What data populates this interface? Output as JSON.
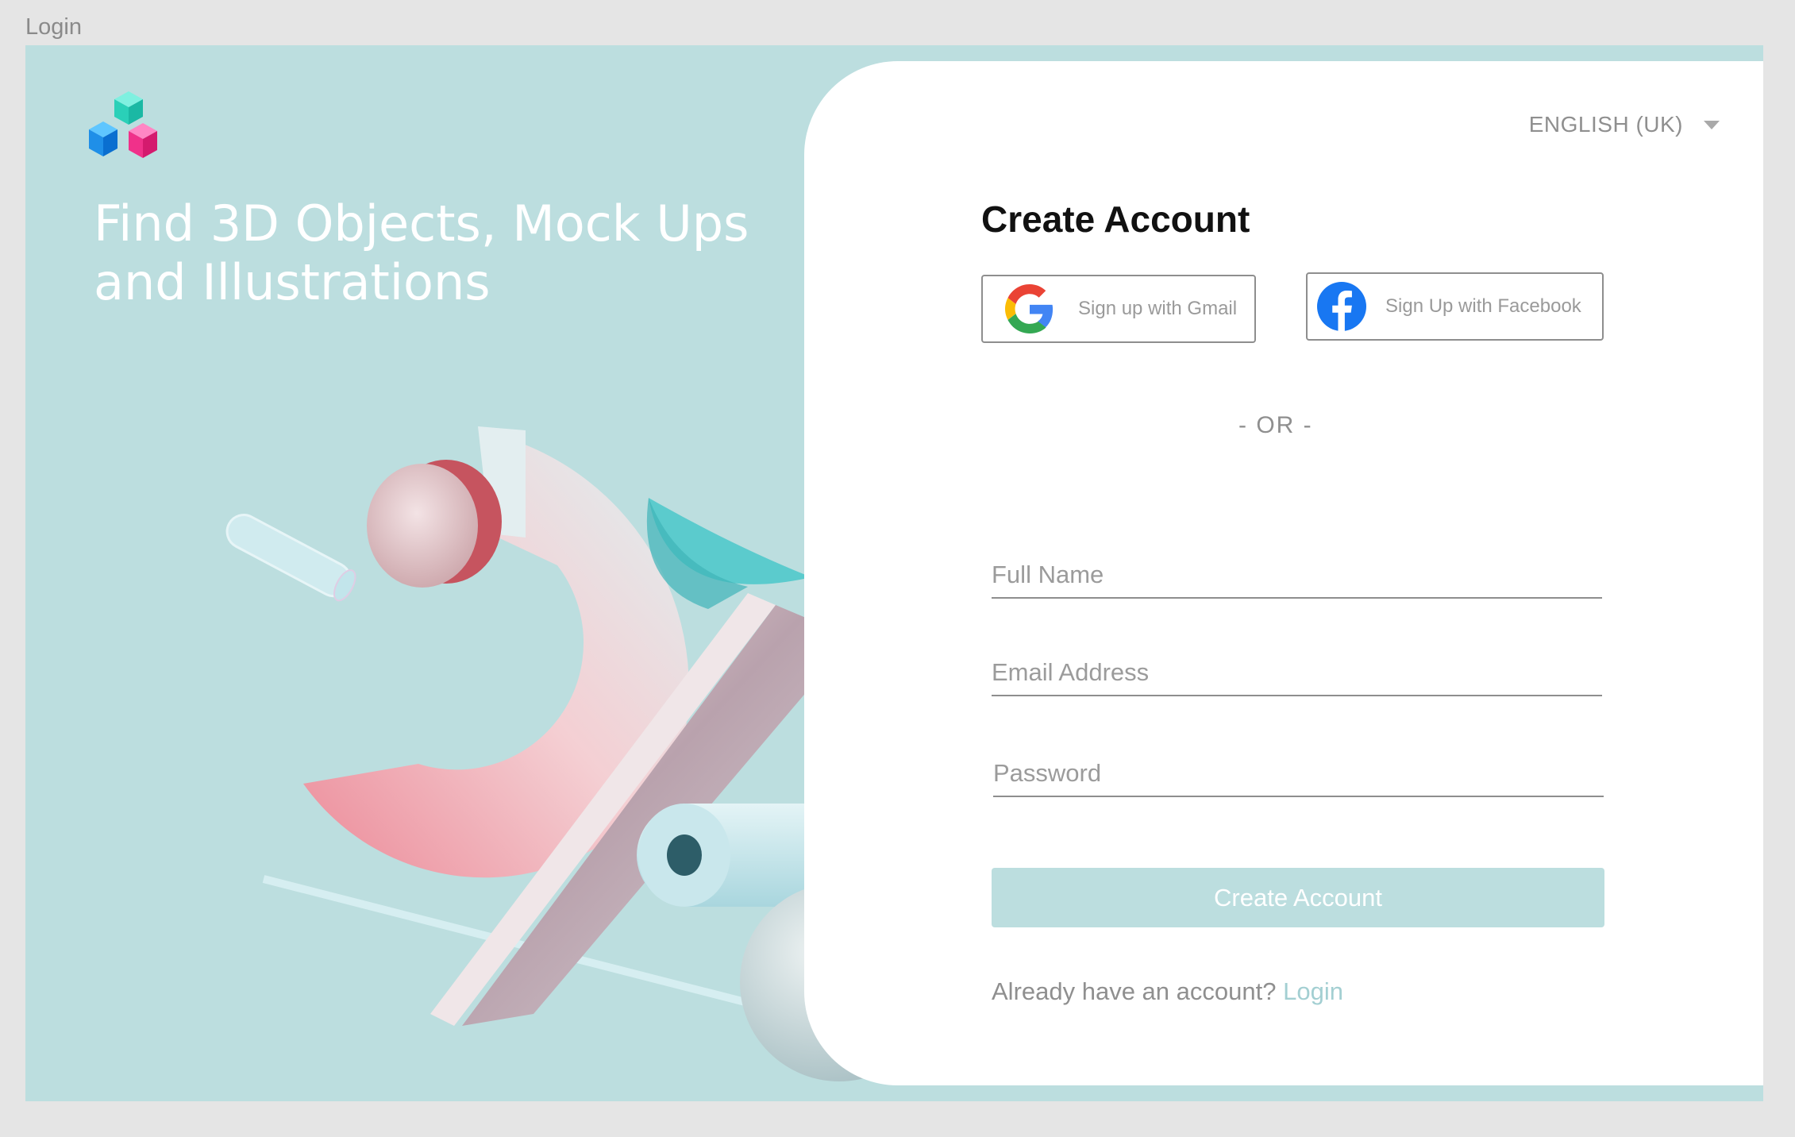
{
  "frame": {
    "label": "Login"
  },
  "hero": {
    "headline_line1": "Find 3D Objects, Mock Ups",
    "headline_line2": "and Illustrations",
    "logo_icon": "cubes-logo-icon",
    "illustration": "3d-percent-shapes-illustration"
  },
  "panel": {
    "language": "ENGLISH (UK)",
    "title": "Create Account",
    "gmail_button": "Sign up with Gmail",
    "facebook_button": "Sign Up with Facebook",
    "divider": "- OR -",
    "fields": {
      "full_name_placeholder": "Full Name",
      "email_placeholder": "Email Address",
      "password_placeholder": "Password"
    },
    "submit_label": "Create Account",
    "login_prompt": "Already have an account?",
    "login_link": "Login"
  },
  "colors": {
    "background": "#bcdedf",
    "accent_link": "#a3cfd2",
    "button": "#bcdedf",
    "facebook_blue": "#1877f2"
  }
}
